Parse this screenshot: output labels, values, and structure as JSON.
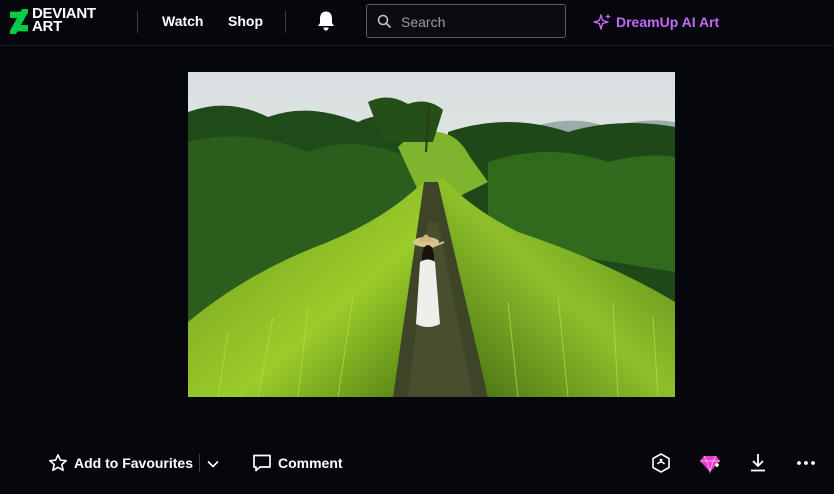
{
  "header": {
    "logo_line1": "DEVIANT",
    "logo_line2": "ART",
    "nav": {
      "watch": "Watch",
      "shop": "Shop"
    },
    "search": {
      "placeholder": "Search",
      "value": ""
    },
    "dreamup_label": "DreamUp AI Art"
  },
  "actions": {
    "favourite_label": "Add to Favourites",
    "comment_label": "Comment"
  },
  "icons": {
    "logo": "deviantart-logo-icon",
    "notifications": "bell-icon",
    "search": "search-icon",
    "dreamup": "sparkle-icon",
    "favourite": "star-icon",
    "dropdown": "chevron-down-icon",
    "comment": "comment-bubble-icon",
    "badge": "badge-icon",
    "gift": "gem-icon",
    "download": "download-icon",
    "more": "more-dots-icon"
  },
  "colors": {
    "background": "#06070d",
    "brand_green": "#05cc47",
    "dreamup_purple": "#c569f5",
    "gem_pink": "#e93ccf"
  }
}
